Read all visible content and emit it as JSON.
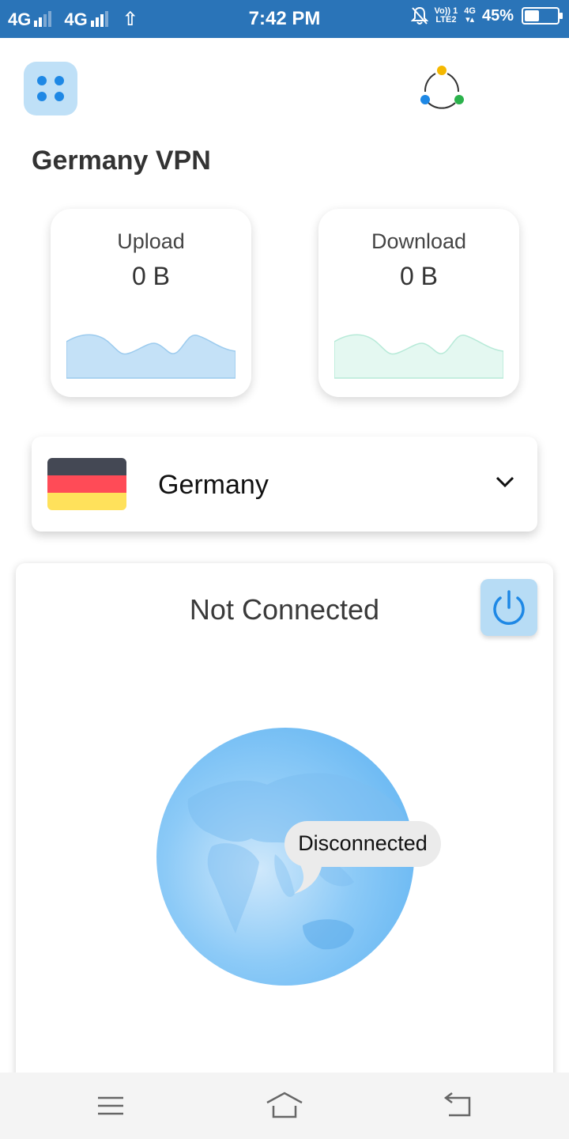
{
  "status_bar": {
    "network_1": "4G",
    "network_2": "4G",
    "time": "7:42 PM",
    "volte_top": "Vo)) 1",
    "volte_bottom": "LTE2",
    "net_small": "4G",
    "battery": "45%",
    "battery_level": 0.45
  },
  "header": {
    "title": "Germany VPN"
  },
  "stats": {
    "upload": {
      "label": "Upload",
      "value": "0 B",
      "color": "#c4e1f7",
      "stroke": "#9ccbee"
    },
    "download": {
      "label": "Download",
      "value": "0 B",
      "color": "#e4f8f1",
      "stroke": "#b7ead8"
    }
  },
  "server": {
    "country": "Germany",
    "flag_colors": [
      "#444854",
      "#ff4b57",
      "#ffe15b"
    ]
  },
  "connection": {
    "status": "Not Connected",
    "bubble": "Disconnected"
  },
  "colors": {
    "status_bar": "#2a74b8",
    "accent": "#1e88e5",
    "accent_light": "#bfe0f7"
  }
}
